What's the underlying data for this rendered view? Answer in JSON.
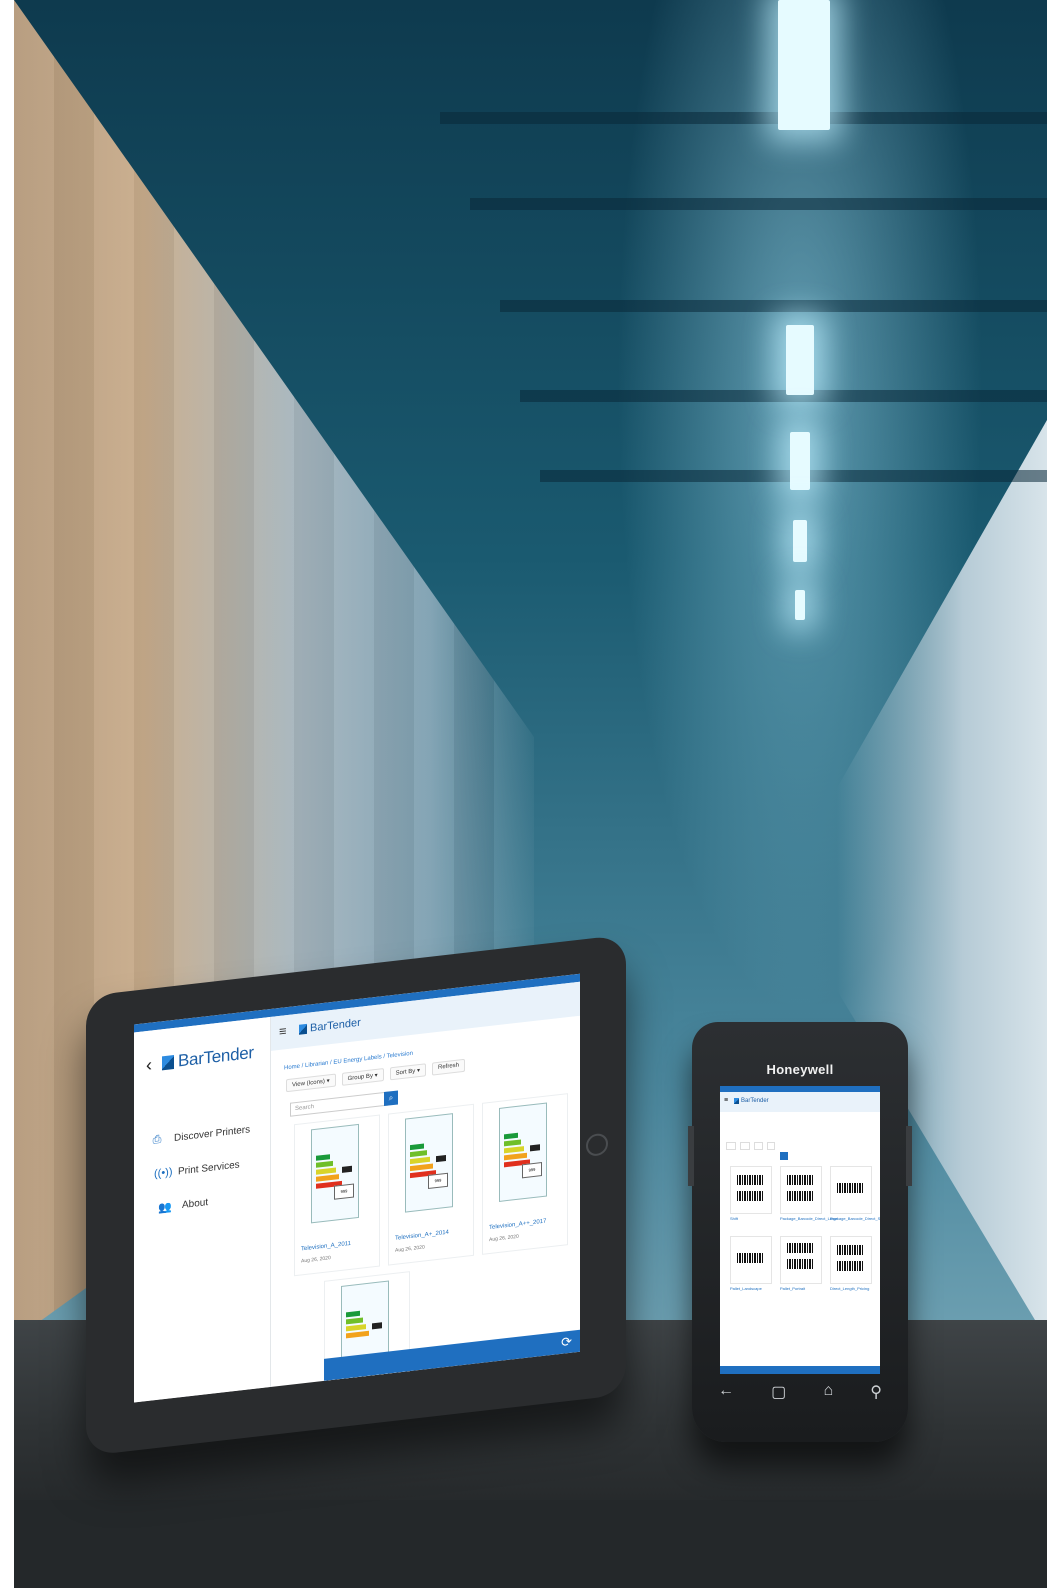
{
  "tablet": {
    "sidebar": {
      "logo": "BarTender",
      "items": [
        {
          "label": "Discover Printers",
          "icon": "printer-icon"
        },
        {
          "label": "Print Services",
          "icon": "broadcast-icon"
        },
        {
          "label": "About",
          "icon": "people-icon"
        }
      ]
    },
    "header_logo": "BarTender",
    "breadcrumb": "Home / Librarian / EU Energy Labels / Television",
    "toolbar": [
      "View (Icons) ▾",
      "Group By ▾",
      "Sort By ▾",
      "Refresh"
    ],
    "search_placeholder": "Search",
    "cards": [
      {
        "name": "Television_A_2011",
        "date": "Aug 26, 2020"
      },
      {
        "name": "Television_A+_2014",
        "date": "Aug 26, 2020"
      },
      {
        "name": "Television_A++_2017",
        "date": "Aug 26, 2020"
      },
      {
        "name": "",
        "date": ""
      }
    ],
    "label_value": "999"
  },
  "handheld": {
    "brand": "Honeywell",
    "header_logo": "BarTender",
    "labels": [
      {
        "name": "Shift"
      },
      {
        "name": "Package_Barcode_Direct_Large"
      },
      {
        "name": "Package_Barcode_Direct_Small"
      },
      {
        "name": "Pallet_Landscape"
      },
      {
        "name": "Pallet_Portrait"
      },
      {
        "name": "Direct_Length_Pricing"
      }
    ],
    "nav_icons": [
      "back-icon",
      "recent-apps-icon",
      "home-icon",
      "search-icon"
    ]
  },
  "colors": {
    "brand_blue": "#1f6fc0",
    "header_tint": "#e9f2fa"
  }
}
